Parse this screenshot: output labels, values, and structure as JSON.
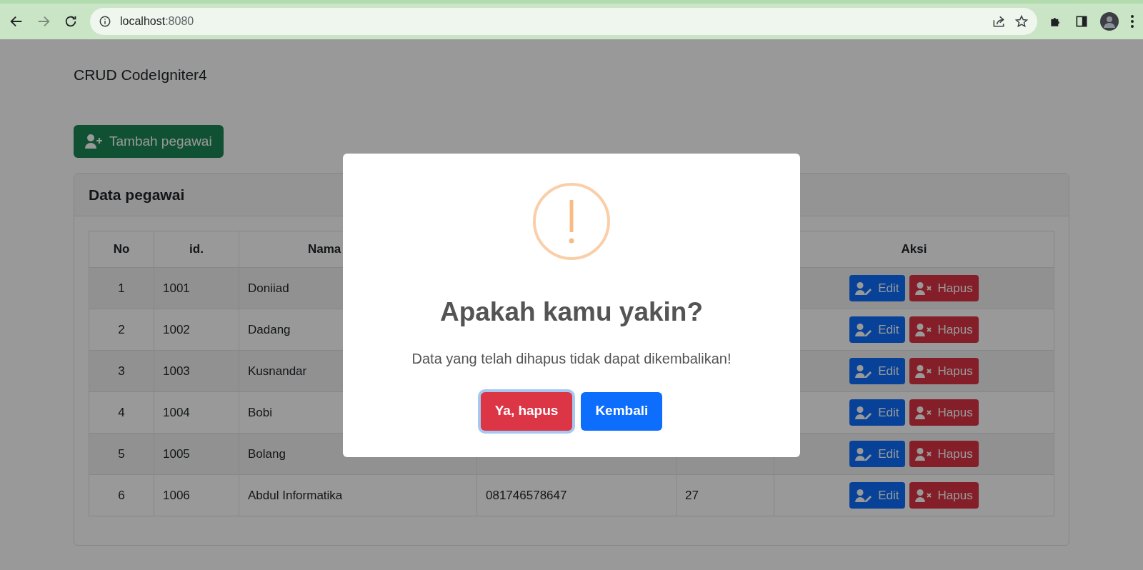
{
  "browser": {
    "url_host": "localhost",
    "url_port": ":8080"
  },
  "page": {
    "title": "CRUD CodeIgniter4",
    "add_button": "Tambah pegawai"
  },
  "card": {
    "title": "Data pegawai",
    "columns": [
      "No",
      "id.",
      "Nama",
      "",
      "",
      "Aksi"
    ],
    "rows": [
      {
        "no": "1",
        "id": "1001",
        "name": "Doniiad",
        "edit": "Edit",
        "delete": "Hapus"
      },
      {
        "no": "2",
        "id": "1002",
        "name": "Dadang",
        "edit": "Edit",
        "delete": "Hapus"
      },
      {
        "no": "3",
        "id": "1003",
        "name": "Kusnandar",
        "edit": "Edit",
        "delete": "Hapus"
      },
      {
        "no": "4",
        "id": "1004",
        "name": "Bobi",
        "edit": "Edit",
        "delete": "Hapus"
      },
      {
        "no": "5",
        "id": "1005",
        "name": "Bolang",
        "edit": "Edit",
        "delete": "Hapus"
      },
      {
        "no": "6",
        "id": "1006",
        "name": "Abdul Informatika",
        "phone": "081746578647",
        "age": "27",
        "edit": "Edit",
        "delete": "Hapus"
      }
    ]
  },
  "dialog": {
    "title": "Apakah kamu yakin?",
    "message": "Data yang telah dihapus tidak dapat dikembalikan!",
    "confirm": "Ya, hapus",
    "cancel": "Kembali",
    "confirm_focused": true
  }
}
